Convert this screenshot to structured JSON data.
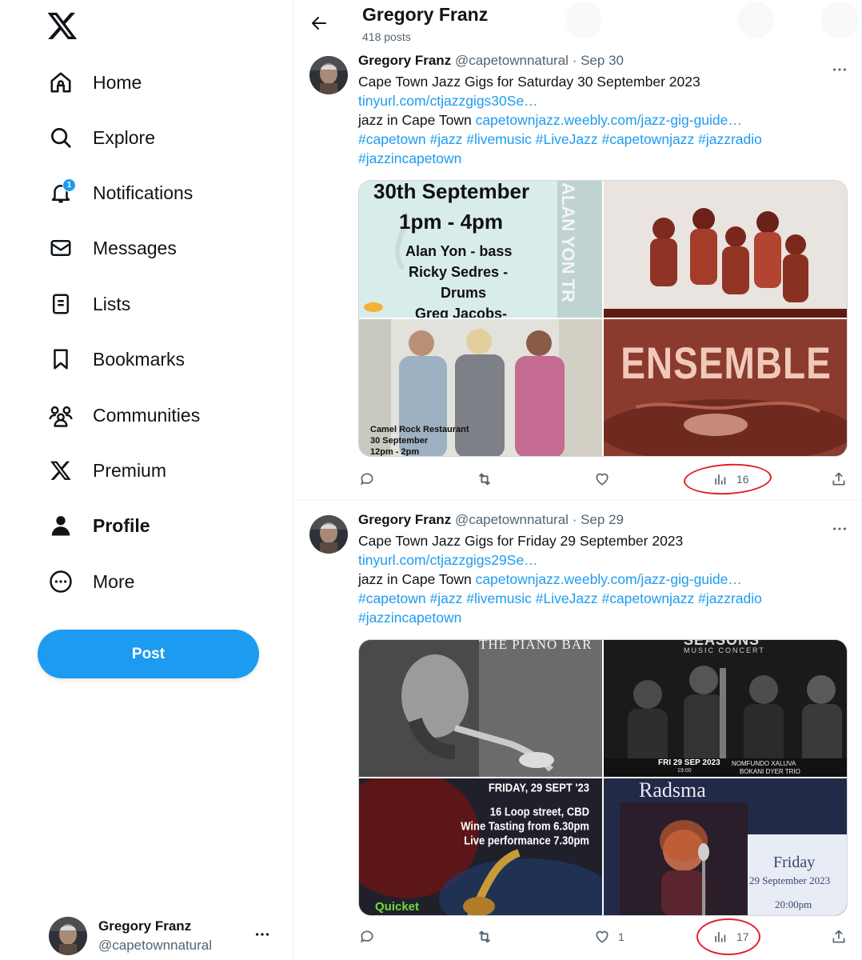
{
  "sidebar": {
    "items": [
      {
        "label": "Home",
        "icon": "home-icon"
      },
      {
        "label": "Explore",
        "icon": "search-icon"
      },
      {
        "label": "Notifications",
        "icon": "bell-icon",
        "badge": "1"
      },
      {
        "label": "Messages",
        "icon": "envelope-icon"
      },
      {
        "label": "Lists",
        "icon": "list-icon"
      },
      {
        "label": "Bookmarks",
        "icon": "bookmark-icon"
      },
      {
        "label": "Communities",
        "icon": "people-icon"
      },
      {
        "label": "Premium",
        "icon": "x-logo-icon"
      },
      {
        "label": "Profile",
        "icon": "person-icon"
      },
      {
        "label": "More",
        "icon": "more-circle-icon"
      }
    ],
    "post_label": "Post",
    "account": {
      "name": "Gregory Franz",
      "handle": "@capetownnatural"
    }
  },
  "header": {
    "name": "Gregory Franz",
    "count": "418 posts"
  },
  "tweets": [
    {
      "name": "Gregory Franz",
      "handle": "@capetownnatural",
      "sep": "·",
      "date": "Sep 30",
      "text1": "Cape Town Jazz Gigs for Saturday 30 September 2023",
      "link1": "tinyurl.com/ctjazzgigs30Se…",
      "text2": "jazz in Cape Town",
      "link2": "capetownjazz.weebly.com/jazz-gig-guide…",
      "hashtags1": "#capetown #jazz #livemusic #LiveJazz #capetownjazz #jazzradio",
      "hashtags2": "#jazzincapetown",
      "media": {
        "tile1": {
          "line1": "30th September",
          "line2": "1pm - 4pm",
          "line3": "Alan Yon - bass",
          "line4": "Ricky Sedres -",
          "line5": "Drums",
          "line6": "Greg Jacobs-",
          "vertical": "ALAN YON TR"
        },
        "tile3": {
          "line1": "Camel Rock Restaurant",
          "line2": "30 September",
          "line3": "12pm - 2pm"
        },
        "tile4": {
          "word": "ENSEMBLE"
        }
      },
      "likes": "",
      "views": "16"
    },
    {
      "name": "Gregory Franz",
      "handle": "@capetownnatural",
      "sep": "·",
      "date": "Sep 29",
      "text1": "Cape Town Jazz Gigs for Friday 29 September 2023",
      "link1": "tinyurl.com/ctjazzgigs29Se…",
      "text2": "jazz in Cape Town",
      "link2": "capetownjazz.weebly.com/jazz-gig-guide…",
      "hashtags1": "#capetown #jazz #livemusic #LiveJazz #capetownjazz #jazzradio",
      "hashtags2": "#jazzincapetown",
      "media": {
        "tile1": {
          "line1": "THE PIANO BAR"
        },
        "tile2": {
          "line1": "SEASONS",
          "line2": "MUSIC CONCERT",
          "line3": "FRI 29 SEP 2023",
          "line4": "19:00",
          "line5": "NOMFUNDO XALUVA",
          "line6": "BOKANI DYER TRIO"
        },
        "tile3": {
          "line1": "FRIDAY, 29 SEPT '23",
          "line2": "16 Loop street, CBD",
          "line3": "Wine Tasting from 6.30pm",
          "line4": "Live performance 7.30pm",
          "line5": "Quicket"
        },
        "tile4": {
          "line1": "Radsma",
          "line2": "Friday",
          "line3": "29 September 2023",
          "line4": "20:00pm"
        }
      },
      "likes": "1",
      "views": "17"
    }
  ],
  "colors": {
    "accent": "#1d9bf0",
    "annotation": "#e0202a",
    "text": "#0f1419",
    "secondary": "#536471"
  }
}
